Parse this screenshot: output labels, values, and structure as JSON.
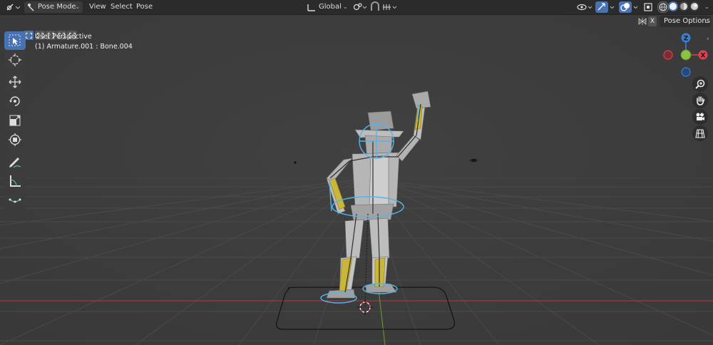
{
  "header": {
    "editor_type_icon": "transform-gizmo-icon",
    "mode_label": "Pose Mode",
    "menus": [
      "View",
      "Select",
      "Pose"
    ],
    "orientation_label": "Global",
    "snap_icon": "snap-icon",
    "proportional_icon": "proportional-icon"
  },
  "subheader": {
    "x_label": "X",
    "pose_options_label": "Pose Options"
  },
  "overlay": {
    "view_name": "User Perspective",
    "object_info": "(1) Armature.001 : Bone.004"
  },
  "gizmo": {
    "axes": [
      "Z",
      "X"
    ],
    "colors": {
      "x": "#e2404f",
      "y": "#8bc23f",
      "z": "#3a7fd6"
    }
  },
  "tools": [
    {
      "name": "select-box-tool",
      "icon": "select-box-icon",
      "active": true
    },
    {
      "name": "cursor-tool",
      "icon": "cursor-icon",
      "active": false
    },
    {
      "name": "move-tool",
      "icon": "move-icon",
      "active": false
    },
    {
      "name": "rotate-tool",
      "icon": "rotate-icon",
      "active": false
    },
    {
      "name": "scale-tool",
      "icon": "scale-icon",
      "active": false
    },
    {
      "name": "transform-tool",
      "icon": "transform-icon",
      "active": false
    },
    {
      "name": "annotate-tool",
      "icon": "annotate-icon",
      "active": false
    },
    {
      "name": "measure-tool",
      "icon": "measure-icon",
      "active": false
    },
    {
      "name": "pose-breakdowner-tool",
      "icon": "breakdowner-icon",
      "active": false
    }
  ],
  "nav_buttons": [
    "zoom-icon",
    "hand-pan-icon",
    "camera-icon",
    "grid-view-icon"
  ],
  "theme": {
    "accent": "#4772b3",
    "viewport_bg": "#3d3d3d",
    "x_axis_line": "#9e3b42",
    "y_axis_line": "#6b8f2e",
    "bone_selected": "#56b4e9",
    "bone_active": "#c9b63a"
  }
}
